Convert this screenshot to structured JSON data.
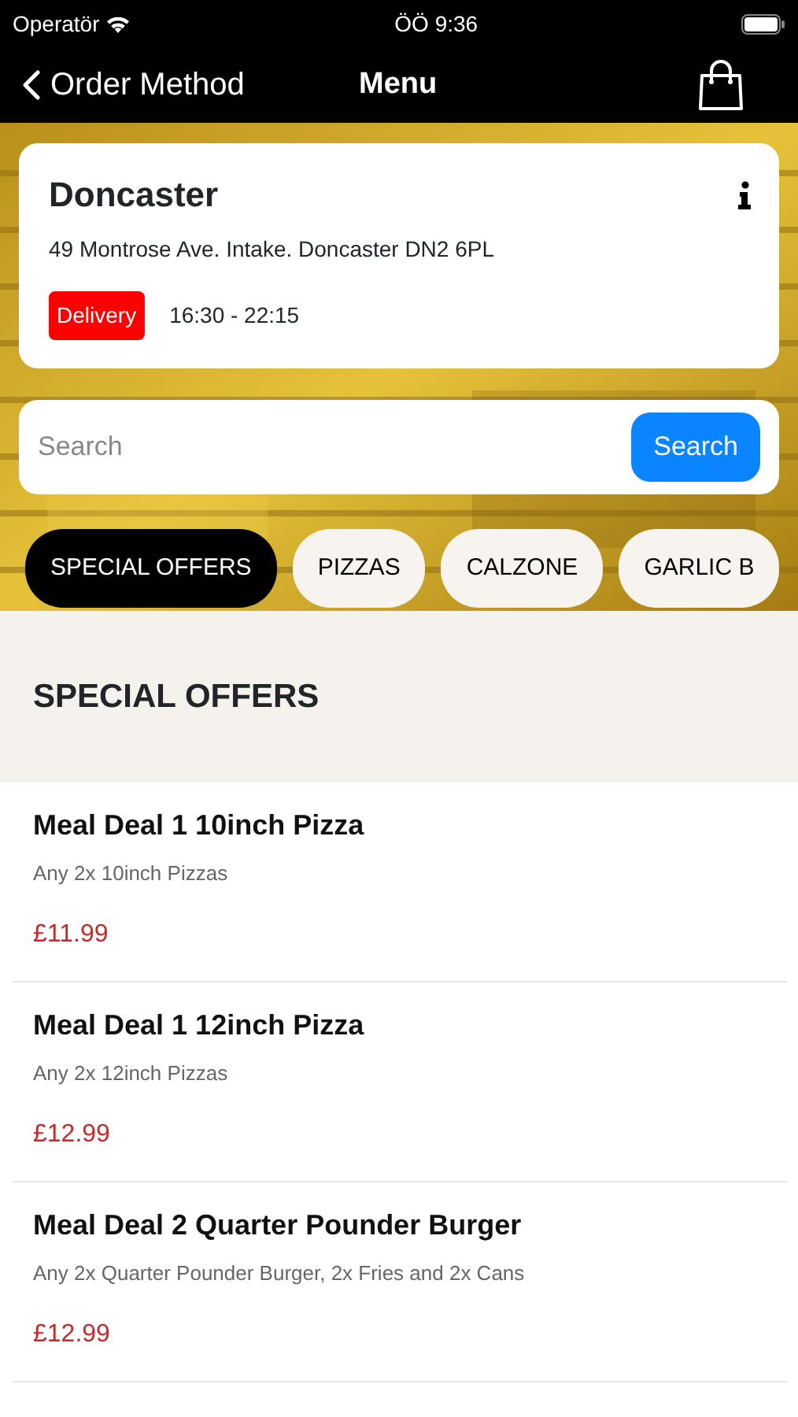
{
  "status_bar": {
    "carrier": "Operatör",
    "time": "ÖÖ 9:36"
  },
  "nav": {
    "back_label": "Order Method",
    "title": "Menu"
  },
  "store": {
    "name": "Doncaster",
    "address": "49 Montrose Ave. Intake. Doncaster DN2 6PL",
    "badge": "Delivery",
    "hours": "16:30 - 22:15"
  },
  "search": {
    "placeholder": "Search",
    "button": "Search"
  },
  "categories": [
    {
      "label": "SPECIAL OFFERS",
      "selected": true
    },
    {
      "label": "PIZZAS",
      "selected": false
    },
    {
      "label": "CALZONE",
      "selected": false
    },
    {
      "label": "GARLIC B",
      "selected": false
    }
  ],
  "section_title": "SPECIAL OFFERS",
  "items": [
    {
      "name": "Meal Deal 1 10inch Pizza",
      "description": "Any 2x 10inch Pizzas",
      "price": "£11.99"
    },
    {
      "name": "Meal Deal 1 12inch Pizza",
      "description": "Any 2x 12inch Pizzas",
      "price": "£12.99"
    },
    {
      "name": "Meal Deal 2 Quarter Pounder Burger",
      "description": "Any 2x Quarter Pounder Burger, 2x Fries and 2x Cans",
      "price": "£12.99"
    }
  ]
}
